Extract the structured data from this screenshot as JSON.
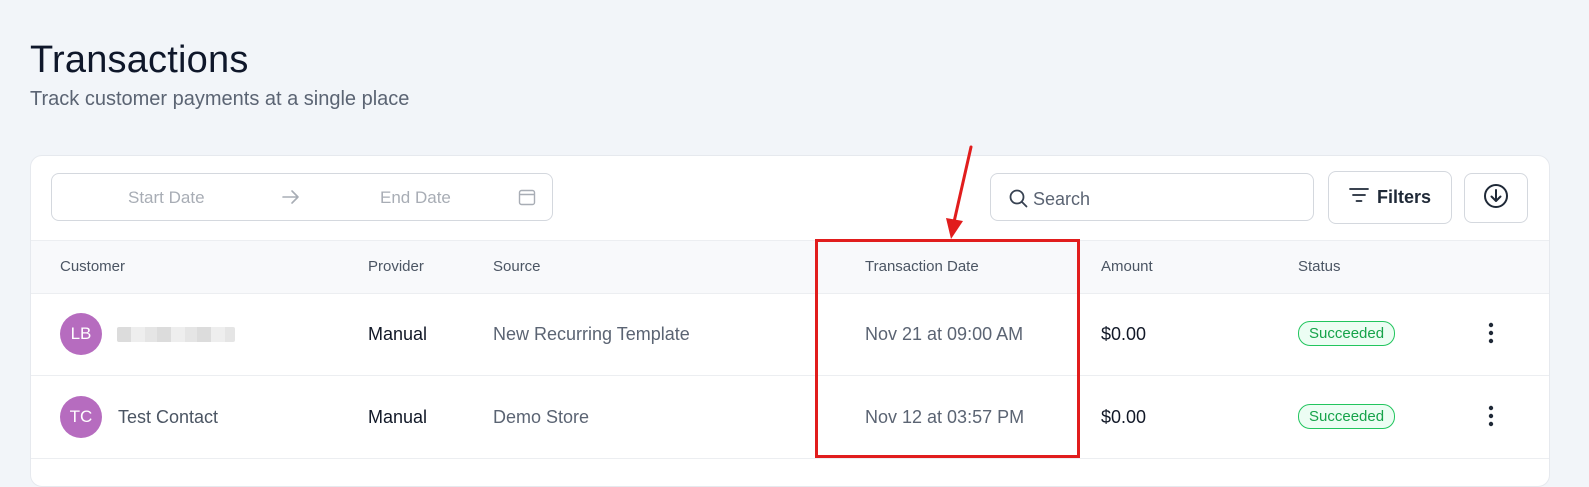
{
  "header": {
    "title": "Transactions",
    "subtitle": "Track customer payments at a single place"
  },
  "toolbar": {
    "date_range": {
      "start_placeholder": "Start Date",
      "end_placeholder": "End Date"
    },
    "search": {
      "placeholder": "Search",
      "value": ""
    },
    "filters_label": "Filters"
  },
  "table": {
    "columns": {
      "customer": "Customer",
      "provider": "Provider",
      "source": "Source",
      "transaction_date": "Transaction Date",
      "amount": "Amount",
      "status": "Status"
    },
    "rows": [
      {
        "initials": "LB",
        "name": "",
        "name_redacted": true,
        "provider": "Manual",
        "source": "New Recurring Template",
        "date": "Nov 21 at 09:00 AM",
        "amount": "$0.00",
        "status": "Succeeded"
      },
      {
        "initials": "TC",
        "name": "Test Contact",
        "name_redacted": false,
        "provider": "Manual",
        "source": "Demo Store",
        "date": "Nov 12 at 03:57 PM",
        "amount": "$0.00",
        "status": "Succeeded"
      }
    ]
  },
  "colors": {
    "avatar": "#b66cbf",
    "status_success": "#16a34a",
    "annotation": "#e11d1d"
  },
  "icons": [
    "arrow-right-icon",
    "calendar-icon",
    "search-icon",
    "filter-icon",
    "download-icon",
    "kebab-menu-icon"
  ]
}
